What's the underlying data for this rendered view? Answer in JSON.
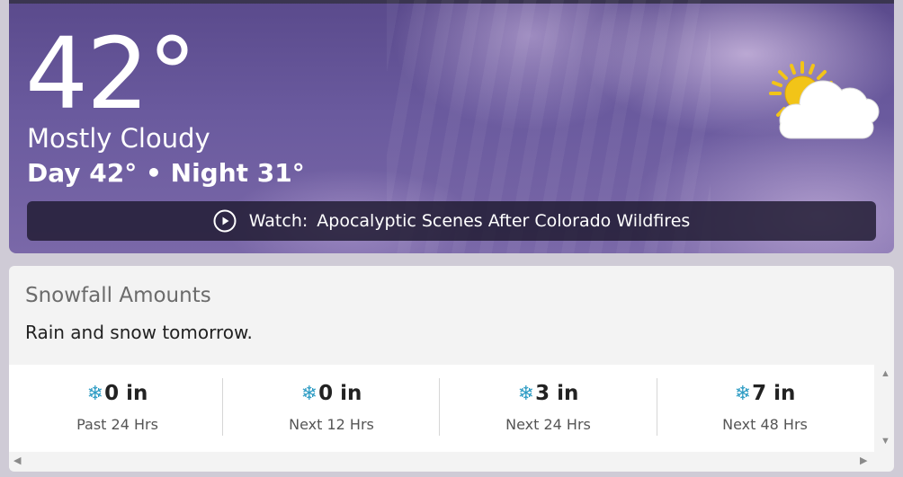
{
  "current": {
    "temperature": "42°",
    "condition": "Mostly Cloudy",
    "day_night": "Day 42° • Night 31°",
    "icon": "partly-cloudy-sun-icon"
  },
  "watch": {
    "prefix": "Watch:",
    "headline": "Apocalyptic Scenes After Colorado Wildfires"
  },
  "snowfall": {
    "title": "Snowfall Amounts",
    "summary": "Rain and snow tomorrow.",
    "periods": [
      {
        "amount": "0 in",
        "label": "Past 24 Hrs"
      },
      {
        "amount": "0 in",
        "label": "Next 12 Hrs"
      },
      {
        "amount": "3 in",
        "label": "Next 24 Hrs"
      },
      {
        "amount": "7 in",
        "label": "Next 48 Hrs"
      }
    ],
    "snow_icon": "❄"
  },
  "colors": {
    "accent_snow": "#2e9cc4",
    "sun": "#f2c418"
  }
}
